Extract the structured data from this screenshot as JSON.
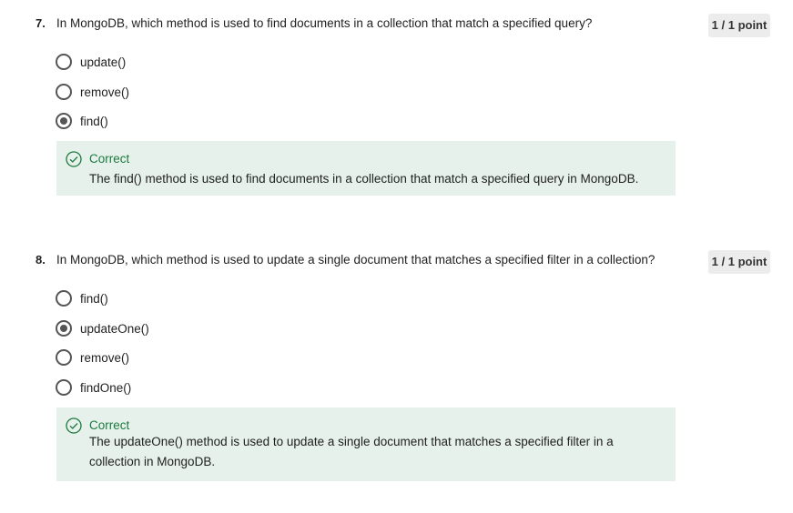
{
  "questions": [
    {
      "number": "7.",
      "text": "In MongoDB, which method is used to find documents in a collection that match a specified query?",
      "points": "1 / 1 point",
      "options": [
        {
          "label": "update()",
          "selected": false
        },
        {
          "label": "remove()",
          "selected": false
        },
        {
          "label": "find()",
          "selected": true
        }
      ],
      "feedback": {
        "title": "Correct",
        "text": "The find() method is used to find documents in a collection that match a specified query in MongoDB."
      }
    },
    {
      "number": "8.",
      "text": "In MongoDB, which method is used to update a single document that matches a specified filter in a collection?",
      "points": "1 / 1 point",
      "options": [
        {
          "label": "find()",
          "selected": false
        },
        {
          "label": "updateOne()",
          "selected": true
        },
        {
          "label": "remove()",
          "selected": false
        },
        {
          "label": "findOne()",
          "selected": false
        }
      ],
      "feedback": {
        "title": "Correct",
        "text": "The updateOne() method is used to update a single document that matches a specified filter in a collection in MongoDB."
      }
    }
  ],
  "colors": {
    "correct_green": "#1b7a3e",
    "feedback_bg": "#e7f1ec",
    "points_bg": "#ececec"
  }
}
